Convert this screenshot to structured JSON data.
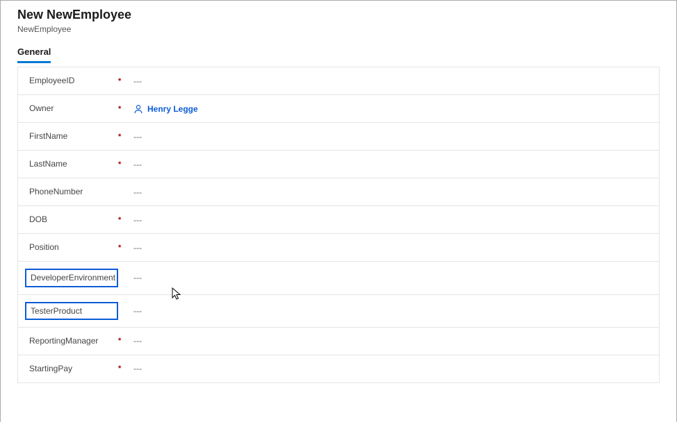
{
  "header": {
    "title": "New NewEmployee",
    "subtitle": "NewEmployee"
  },
  "tabs": {
    "general": "General"
  },
  "fields": {
    "employeeId": {
      "label": "EmployeeID",
      "required": "*",
      "value": "---"
    },
    "owner": {
      "label": "Owner",
      "required": "*",
      "value": "Henry Legge"
    },
    "firstName": {
      "label": "FirstName",
      "required": "*",
      "value": "---"
    },
    "lastName": {
      "label": "LastName",
      "required": "*",
      "value": "---"
    },
    "phoneNumber": {
      "label": "PhoneNumber",
      "required": "",
      "value": "---"
    },
    "dob": {
      "label": "DOB",
      "required": "*",
      "value": "---"
    },
    "position": {
      "label": "Position",
      "required": "*",
      "value": "---"
    },
    "devEnv": {
      "label": "DeveloperEnvironment",
      "required": "",
      "value": "---"
    },
    "testerProduct": {
      "label": "TesterProduct",
      "required": "",
      "value": "---"
    },
    "reportingManager": {
      "label": "ReportingManager",
      "required": "*",
      "value": "---"
    },
    "startingPay": {
      "label": "StartingPay",
      "required": "*",
      "value": "---"
    }
  }
}
